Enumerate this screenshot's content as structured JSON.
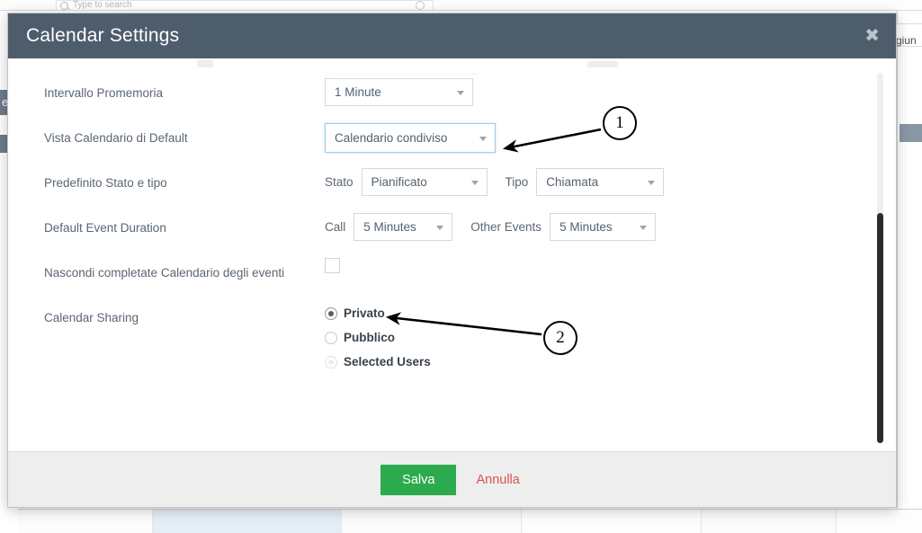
{
  "background": {
    "search": {
      "placeholder": "Type to search",
      "icon": "search-icon",
      "clear_icon": "clear-circle-icon"
    },
    "left_rail_letter": "e",
    "right_fragment_text": "giun"
  },
  "modal": {
    "title": "Calendar Settings",
    "close_icon": "✖",
    "rows": [
      {
        "label": "Intervallo Promemoria",
        "control": "select",
        "value": "1 Minute"
      },
      {
        "label": "Vista Calendario di Default",
        "control": "select",
        "value": "Calendario condiviso",
        "focused": true
      },
      {
        "label": "Predefinito Stato e tipo",
        "control": "dual-select",
        "first_label": "Stato",
        "first_value": "Pianificato",
        "second_label": "Tipo",
        "second_value": "Chiamata"
      },
      {
        "label": "Default Event Duration",
        "control": "dual-select",
        "first_label": "Call",
        "first_value": "5 Minutes",
        "second_label": "Other Events",
        "second_value": "5 Minutes"
      },
      {
        "label": "Nascondi completate Calendario degli eventi",
        "control": "checkbox",
        "checked": false
      },
      {
        "label": "Calendar Sharing",
        "control": "radio-group",
        "options": [
          {
            "label": "Privato",
            "selected": true
          },
          {
            "label": "Pubblico",
            "selected": false
          },
          {
            "label": "Selected Users",
            "selected": false
          }
        ]
      }
    ],
    "footer": {
      "save_label": "Salva",
      "cancel_label": "Annulla"
    }
  },
  "annotations": [
    {
      "number": "1",
      "target": "default-calendar-view-select"
    },
    {
      "number": "2",
      "target": "calendar-sharing-private-radio"
    }
  ],
  "colors": {
    "header": "#4e5d6c",
    "save_button": "#2bab4b",
    "cancel_link": "#d9534f",
    "focus_border": "#9fcdea",
    "label_text": "#5a6673"
  }
}
